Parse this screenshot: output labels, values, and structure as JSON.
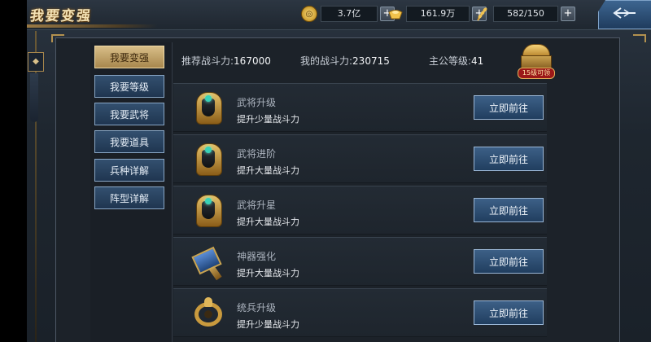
{
  "header": {
    "title": "我要变强",
    "resources": [
      {
        "name": "copper-coin",
        "icon": "coin-icon",
        "value": "3.7亿",
        "color": "#e3b33b"
      },
      {
        "name": "gold-ingot",
        "icon": "ingot-icon",
        "value": "161.9万",
        "color": "#f1c24b"
      },
      {
        "name": "grain",
        "icon": "wheat-icon",
        "value": "582/150",
        "color": "#d9a13a"
      }
    ],
    "back_icon": "back-arrow-icon"
  },
  "sidebar": {
    "items": [
      {
        "label": "我要变强",
        "active": true
      },
      {
        "label": "我要等级",
        "active": false
      },
      {
        "label": "我要武将",
        "active": false
      },
      {
        "label": "我要道具",
        "active": false
      },
      {
        "label": "兵种详解",
        "active": false
      },
      {
        "label": "阵型详解",
        "active": false
      }
    ]
  },
  "info": {
    "recommended_label": "推荐战斗力:",
    "recommended_value": "167000",
    "my_power_label": "我的战斗力:",
    "my_power_value": "230715",
    "level_label": "主公等级:",
    "level_value": "41",
    "chest_tag": "15级可领"
  },
  "list": {
    "rows": [
      {
        "title": "武将升级",
        "desc": "提升少量战斗力",
        "button": "立即前往",
        "icon": "helmet-icon"
      },
      {
        "title": "武将进阶",
        "desc": "提升大量战斗力",
        "button": "立即前往",
        "icon": "helmet-icon"
      },
      {
        "title": "武将升星",
        "desc": "提升大量战斗力",
        "button": "立即前往",
        "icon": "helmet-icon"
      },
      {
        "title": "神器强化",
        "desc": "提升大量战斗力",
        "button": "立即前往",
        "icon": "hammer-icon"
      },
      {
        "title": "统兵升级",
        "desc": "提升少量战斗力",
        "button": "立即前往",
        "icon": "ring-icon"
      }
    ]
  },
  "colors": {
    "accent_gold": "#d8be88",
    "button_blue": "#3d6087",
    "panel_bg": "#1e262f"
  }
}
